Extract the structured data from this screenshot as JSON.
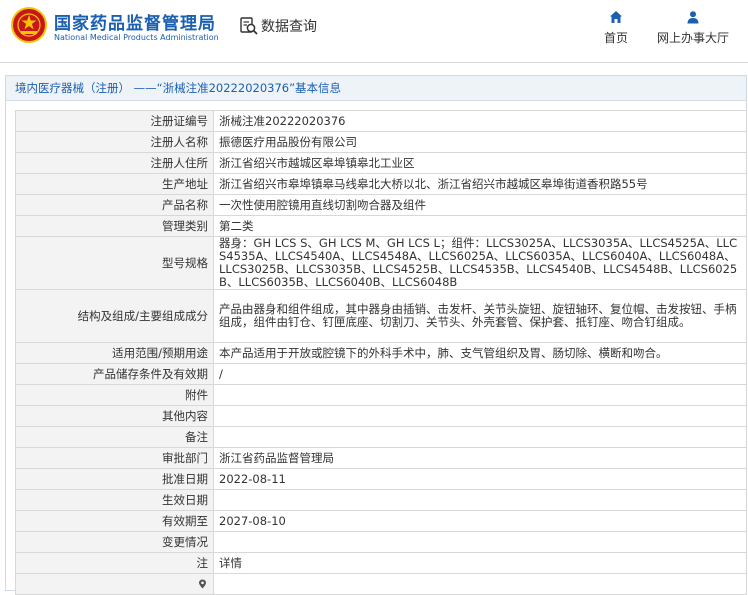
{
  "header": {
    "org_name_cn": "国家药品监督管理局",
    "org_name_en": "National Medical Products Administration",
    "search_label": "数据查询",
    "nav": {
      "home": "首页",
      "online_service": "网上办事大厅"
    }
  },
  "panel": {
    "breadcrumb": "境内医疗器械（注册） ——“浙械注准20222020376”基本信息"
  },
  "rows": [
    {
      "label": "注册证编号",
      "value": "浙械注准20222020376"
    },
    {
      "label": "注册人名称",
      "value": "振德医疗用品股份有限公司"
    },
    {
      "label": "注册人住所",
      "value": "浙江省绍兴市越城区皋埠镇皋北工业区"
    },
    {
      "label": "生产地址",
      "value": "浙江省绍兴市皋埠镇皋马线皋北大桥以北、浙江省绍兴市越城区皋埠街道香积路55号"
    },
    {
      "label": "产品名称",
      "value": "一次性使用腔镜用直线切割吻合器及组件"
    },
    {
      "label": "管理类别",
      "value": "第二类"
    },
    {
      "label": "型号规格",
      "value": "器身：GH LCS S、GH LCS M、GH LCS L；组件：LLCS3025A、LLCS3035A、LLCS4525A、LLCS4535A、LLCS4540A、LLCS4548A、LLCS6025A、LLCS6035A、LLCS6040A、LLCS6048A、LLCS3025B、LLCS3035B、LLCS4525B、LLCS4535B、LLCS4540B、LLCS4548B、LLCS6025B、LLCS6035B、LLCS6040B、LLCS6048B"
    },
    {
      "label": "结构及组成/主要组成成分",
      "value": "产品由器身和组件组成，其中器身由插销、击发杆、关节头旋钮、旋钮轴环、复位帽、击发按钮、手柄组成，组件由钉仓、钉匣底座、切割刀、关节头、外壳套管、保护套、抵钉座、吻合钉组成。"
    },
    {
      "label": "适用范围/预期用途",
      "value": "本产品适用于开放或腔镜下的外科手术中，肺、支气管组织及胃、肠切除、横断和吻合。"
    },
    {
      "label": "产品储存条件及有效期",
      "value": "/"
    },
    {
      "label": "附件",
      "value": ""
    },
    {
      "label": "其他内容",
      "value": ""
    },
    {
      "label": "备注",
      "value": ""
    },
    {
      "label": "审批部门",
      "value": "浙江省药品监督管理局"
    },
    {
      "label": "批准日期",
      "value": "2022-08-11"
    },
    {
      "label": "生效日期",
      "value": ""
    },
    {
      "label": "有效期至",
      "value": "2027-08-10"
    },
    {
      "label": "变更情况",
      "value": ""
    },
    {
      "label": "注",
      "value": "详情"
    }
  ],
  "colors": {
    "brand_blue": "#1b5fb0",
    "emblem_red": "#c8161d",
    "emblem_gold": "#f5c400"
  },
  "icons": {
    "home": "home-icon",
    "user": "user-icon",
    "search": "search-magnifier-icon",
    "emblem": "national-emblem-icon",
    "note": "map-pin-icon"
  }
}
